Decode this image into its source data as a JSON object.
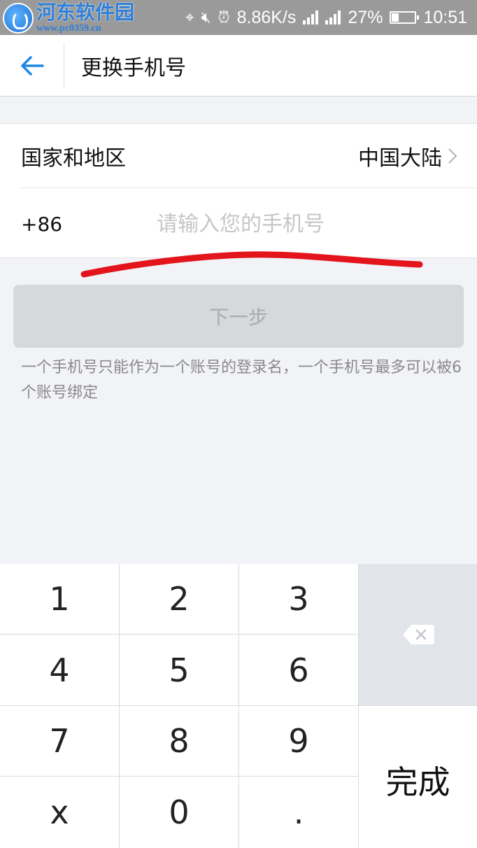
{
  "status_bar": {
    "watermark_title": "河东软件园",
    "watermark_url": "www.pc0359.cn",
    "network_speed": "8.86K/s",
    "network_type": "4G",
    "sim2": "G",
    "battery_percent": "27%",
    "battery_level": 0.27,
    "time": "10:51"
  },
  "header": {
    "title": "更换手机号"
  },
  "form": {
    "country_label": "国家和地区",
    "country_value": "中国大陆",
    "phone_prefix": "+86",
    "phone_placeholder": "请输入您的手机号",
    "phone_value": ""
  },
  "next_button": {
    "label": "下一步"
  },
  "hint": {
    "text": "一个手机号只能作为一个账号的登录名，一个手机号最多可以被6个账号绑定"
  },
  "keyboard": {
    "keys": [
      "1",
      "2",
      "3",
      "4",
      "5",
      "6",
      "7",
      "8",
      "9",
      "x",
      "0",
      "."
    ],
    "done_label": "完成"
  },
  "colors": {
    "accent": "#1e88e5",
    "annotation_red": "#e3141b",
    "disabled_button": "#d7d8dc"
  }
}
